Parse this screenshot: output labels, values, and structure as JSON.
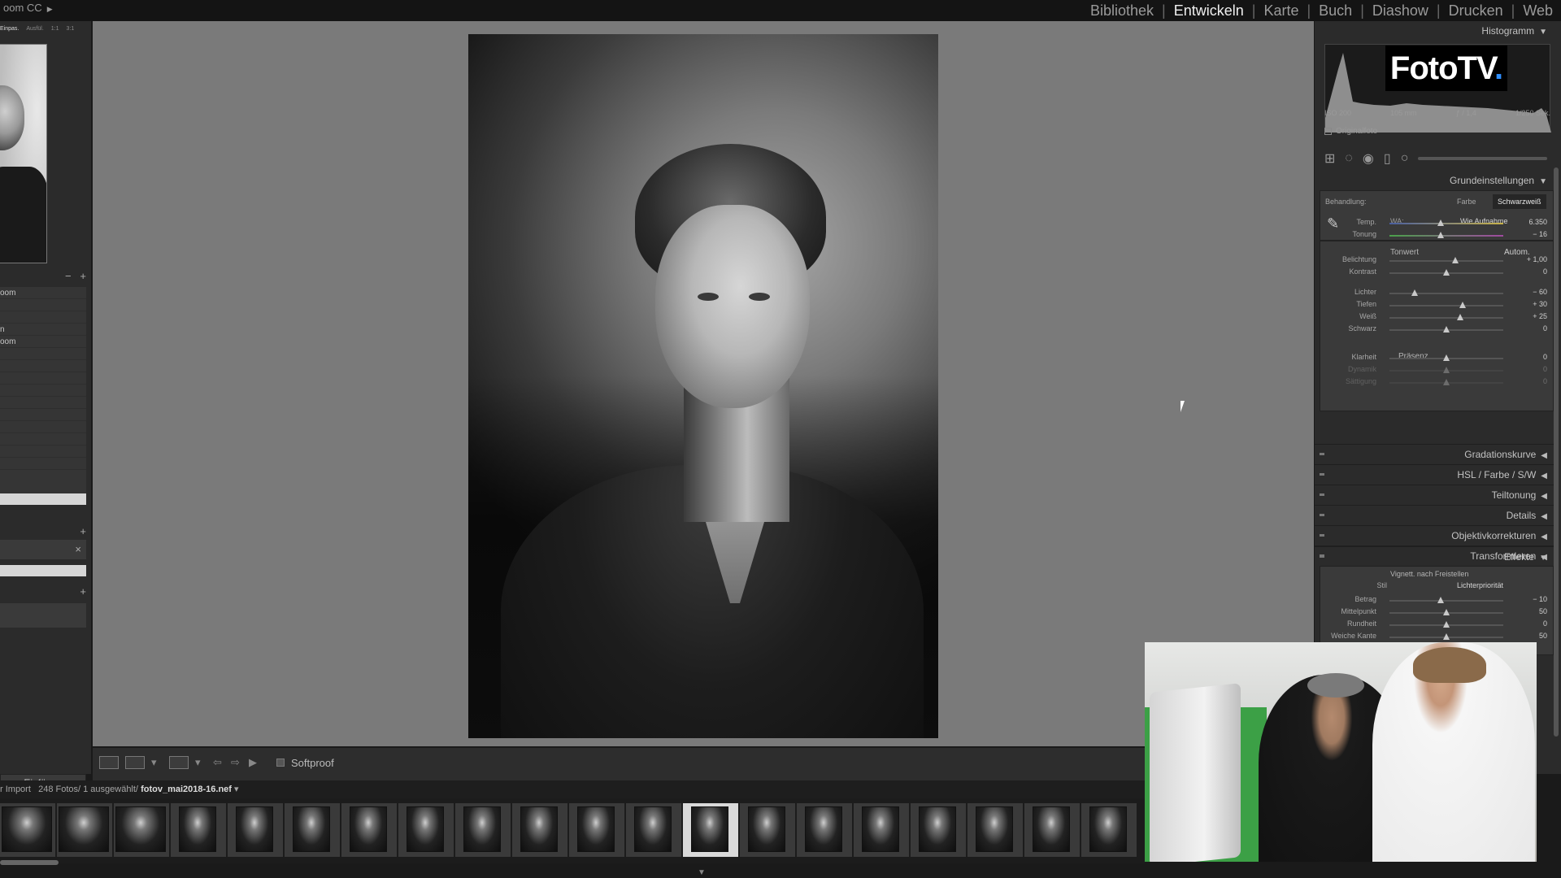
{
  "app": {
    "title": "oom CC"
  },
  "modules": [
    "Bibliothek",
    "Entwickeln",
    "Karte",
    "Buch",
    "Diashow",
    "Drucken",
    "Web"
  ],
  "active_module": "Entwickeln",
  "navigator": {
    "tabs": [
      "Einpas.",
      "Ausfül.",
      "1:1",
      "3:1"
    ]
  },
  "left_panel": {
    "presets": [
      "oom",
      "",
      "",
      "n",
      "oom",
      "",
      "",
      "",
      "",
      "",
      "",
      "",
      "",
      "",
      ""
    ],
    "minus": "−",
    "plus": "+",
    "plus2": "+",
    "close": "×",
    "plus3": "+",
    "paste_button": "Einfügen"
  },
  "toolbar": {
    "softproof": "Softproof"
  },
  "filmstrip": {
    "source": "r Import",
    "count": "248 Fotos/ 1 ausgewählt/",
    "filename": "fotov_mai2018-16.nef",
    "thumb_count": 20,
    "selected_index": 12
  },
  "right_panel": {
    "histogram_title": "Histogramm",
    "logo_text": "FotoTV",
    "logo_dot": ".",
    "meta": {
      "iso": "ISO 200",
      "focal": "105 mm",
      "aperture": "ƒ / 1,4",
      "shutter": "1/250 Sek."
    },
    "original_photo": "Originalfoto",
    "basic": {
      "title": "Grundeinstellungen",
      "treatment_label": "Behandlung:",
      "treatment_color": "Farbe",
      "treatment_bw": "Schwarzweiß",
      "wb_label": "WA:",
      "wb_value": "Wie Aufnahme",
      "tone_title": "Tonwert",
      "tone_auto": "Autom.",
      "presence_title": "Präsenz",
      "sliders": [
        {
          "label": "Temp.",
          "value": "6.350",
          "pos": 0.45
        },
        {
          "label": "Tonung",
          "value": "− 16",
          "pos": 0.45
        },
        {
          "label": "Belichtung",
          "value": "+ 1,00",
          "pos": 0.58
        },
        {
          "label": "Kontrast",
          "value": "0",
          "pos": 0.5
        },
        {
          "label": "Lichter",
          "value": "− 60",
          "pos": 0.22
        },
        {
          "label": "Tiefen",
          "value": "+ 30",
          "pos": 0.64
        },
        {
          "label": "Weiß",
          "value": "+ 25",
          "pos": 0.62
        },
        {
          "label": "Schwarz",
          "value": "0",
          "pos": 0.5
        },
        {
          "label": "Klarheit",
          "value": "0",
          "pos": 0.5
        },
        {
          "label": "Dynamik",
          "value": "0",
          "pos": 0.5
        },
        {
          "label": "Sättigung",
          "value": "0",
          "pos": 0.5
        }
      ]
    },
    "collapsed_panels": [
      {
        "title": "Gradationskurve"
      },
      {
        "title": "HSL / Farbe / S/W"
      },
      {
        "title": "Teiltonung"
      },
      {
        "title": "Details"
      },
      {
        "title": "Objektivkorrekturen"
      },
      {
        "title": "Transformieren"
      }
    ],
    "effects": {
      "title": "Effekte",
      "vignette_title": "Vignett. nach Freistellen",
      "style_label": "Stil",
      "style_value": "Lichterpriorität",
      "sliders": [
        {
          "label": "Betrag",
          "value": "− 10",
          "pos": 0.45
        },
        {
          "label": "Mittelpunkt",
          "value": "50",
          "pos": 0.5
        },
        {
          "label": "Rundheit",
          "value": "0",
          "pos": 0.5
        },
        {
          "label": "Weiche Kante",
          "value": "50",
          "pos": 0.5
        }
      ]
    }
  },
  "colors": {
    "accent": "#2f8fff",
    "panel": "#2b2b2b",
    "canvas": "#7a7a7a"
  }
}
